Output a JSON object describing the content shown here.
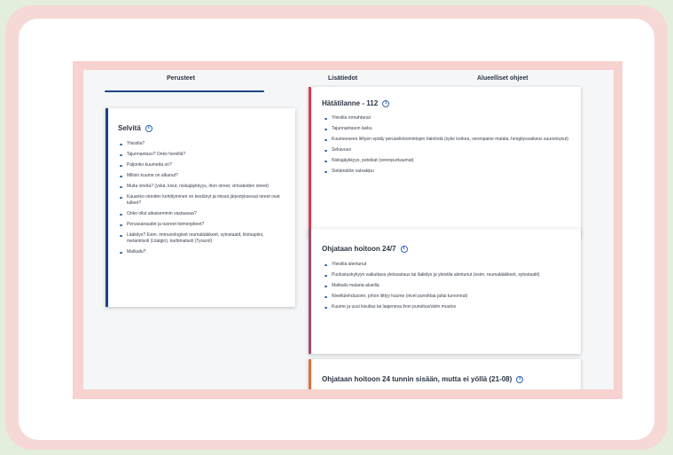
{
  "tabs": [
    {
      "label": "Perusteet"
    },
    {
      "label": "Lisätiedot"
    },
    {
      "label": "Alueelliset ohjeet"
    }
  ],
  "colors": {
    "active_tab_underline": "#1c4683",
    "left_panel_accent": "#1c4683",
    "emergency_accent": "#e03a4c",
    "urgent_accent": "#a14d72",
    "same_day_accent": "#e0703a",
    "info_icon": "#2e65b5"
  },
  "left_panel": {
    "title": "Selvitä",
    "icon": "info-icon",
    "items": [
      "Yleistila?",
      "Tajunnantaso? Onko hereillä?",
      "Paljonko kuumetta on?",
      "Milloin kuume on alkanut?",
      "Muita oireita? (yskä, kivut, niskajäykkyys, ihon oireet, virtsateiden oireet)",
      "Kauanko oireiden kehittyminen on kestänyt ja missä järjestyksessä oireet ovat tulleet?",
      "Onko ollut aikaisemmin vastaavaa?",
      "Perussairaudet ja tuoreet toimenpiteet?",
      "Lääkitys? Esim. immunologiset reumalääkkeet, sytostaatit, klotsapiini, metamitsoli (Litalgin), karbimatsoli (Tyrazol)",
      "Matkailu?"
    ]
  },
  "panels": [
    {
      "title": "Hätätilanne - 112",
      "icon": "info-icon",
      "items": [
        "Yleistila romahtanut",
        "Tajunnantason lasku",
        "Kuumeeseen liittyen epäily peruselintoimintojen häiriöstä (syke korkea, verenpaine matala, hengitysvaikeus suurentunut)",
        "Sekavuus",
        "Niskajäykkyys, petekiat (verenpurkaumat)",
        "Sietämätön vatsakipu"
      ]
    },
    {
      "title": "Ohjataan hoitoon 24/7",
      "icon": "info-icon",
      "items": [
        "Yleistila alentunut",
        "Puolustuskykyyn vaikuttava yleissairaus tai lääkitys ja yleistila alentunut (esim. reumalääkkeet, sytostaatit)",
        "Matkailu malaria-alueilla",
        "Niveltulehdusoire, johon liittyy kuume (nivel punoittaa ja/tai turvonnut)",
        "Kuume ja uusi kivulias tai laajeneva ihon punoitus/värin muutos"
      ]
    },
    {
      "title": "Ohjataan hoitoon 24 tunnin sisään, mutta ei yöllä (21-08)",
      "icon": "info-icon",
      "items": []
    }
  ]
}
